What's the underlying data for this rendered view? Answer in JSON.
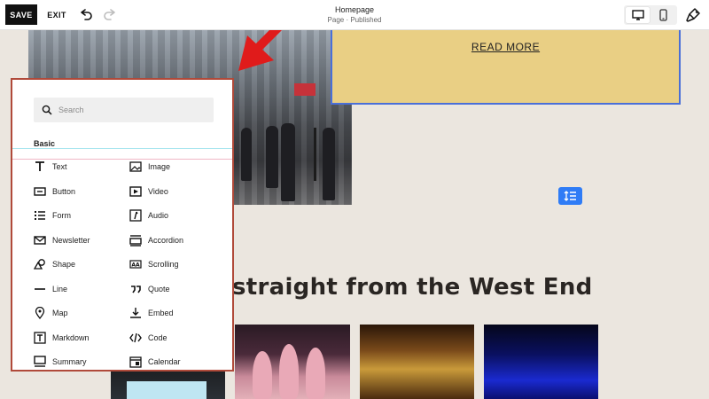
{
  "toolbar": {
    "save_label": "SAVE",
    "exit_label": "EXIT",
    "page_title": "Homepage",
    "page_status": "Page · Published"
  },
  "canvas": {
    "read_more": "READ MORE",
    "heading": "straight from the West End"
  },
  "panel": {
    "search_placeholder": "Search",
    "section_label": "Basic",
    "items": [
      {
        "label": "Text",
        "icon": "text-icon"
      },
      {
        "label": "Image",
        "icon": "image-icon"
      },
      {
        "label": "Button",
        "icon": "button-icon"
      },
      {
        "label": "Video",
        "icon": "video-icon"
      },
      {
        "label": "Form",
        "icon": "form-icon"
      },
      {
        "label": "Audio",
        "icon": "audio-icon"
      },
      {
        "label": "Newsletter",
        "icon": "newsletter-icon"
      },
      {
        "label": "Accordion",
        "icon": "accordion-icon"
      },
      {
        "label": "Shape",
        "icon": "shape-icon"
      },
      {
        "label": "Scrolling",
        "icon": "scrolling-icon"
      },
      {
        "label": "Line",
        "icon": "line-icon"
      },
      {
        "label": "Quote",
        "icon": "quote-icon"
      },
      {
        "label": "Map",
        "icon": "map-pin-icon"
      },
      {
        "label": "Embed",
        "icon": "embed-icon"
      },
      {
        "label": "Markdown",
        "icon": "markdown-icon"
      },
      {
        "label": "Code",
        "icon": "code-icon"
      },
      {
        "label": "Summary",
        "icon": "summary-icon"
      },
      {
        "label": "Calendar",
        "icon": "calendar-icon"
      }
    ]
  },
  "colors": {
    "panel_border": "#b04a3a",
    "arrow": "#e01b1b",
    "accent_blue": "#2f7cf6",
    "card_yellow": "#e9cf84"
  }
}
